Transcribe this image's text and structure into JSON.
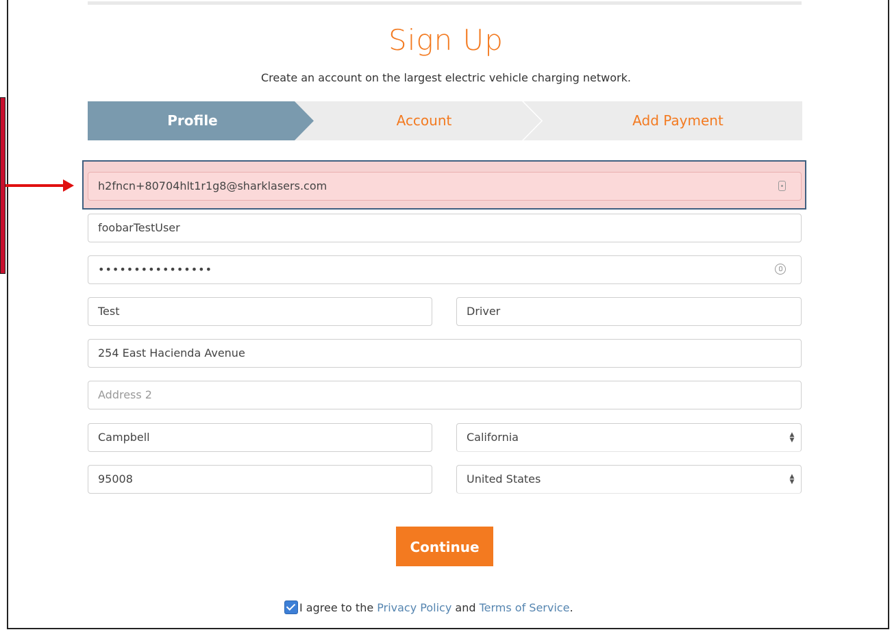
{
  "title": "Sign Up",
  "subtitle": "Create an account on the largest electric vehicle charging network.",
  "steps": [
    {
      "label": "Profile"
    },
    {
      "label": "Account"
    },
    {
      "label": "Add Payment"
    }
  ],
  "form": {
    "email": {
      "value": "h2fncn+80704hlt1r1g8@sharklasers.com"
    },
    "username": {
      "value": "foobarTestUser"
    },
    "password": {
      "value": "••••••••••••••••"
    },
    "first_name": {
      "value": "Test"
    },
    "last_name": {
      "value": "Driver"
    },
    "address1": {
      "value": "254 East Hacienda Avenue"
    },
    "address2": {
      "value": "",
      "placeholder": "Address 2"
    },
    "city": {
      "value": "Campbell"
    },
    "state": {
      "value": "California"
    },
    "zip": {
      "value": "95008"
    },
    "country": {
      "value": "United States"
    }
  },
  "continue_label": "Continue",
  "agree": {
    "prefix": "I agree to the ",
    "privacy": "Privacy Policy",
    "and": " and ",
    "terms": "Terms of Service",
    "suffix": ".",
    "checked": true
  },
  "colors": {
    "brand_orange": "#f37a20",
    "step_active": "#7a9aae",
    "error_bg": "#fbd9d9",
    "annotation_red": "#e01010"
  }
}
